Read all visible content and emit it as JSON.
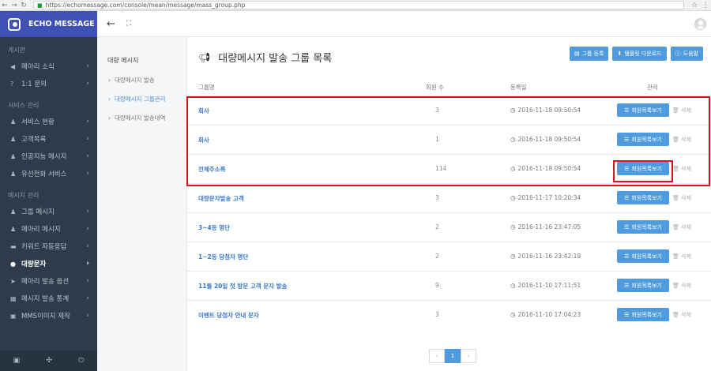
{
  "browser": {
    "url": "https://echomessage.com/console/mean/message/mass_group.php"
  },
  "sidebar": {
    "brand": "ECHO MESSAGE",
    "sections": [
      {
        "title": "게시판",
        "items": [
          {
            "icon": "megaphone-icon",
            "glyph": "◀",
            "label": "메아리 소식",
            "active": false
          },
          {
            "icon": "question-icon",
            "glyph": "?",
            "label": "1:1 문의",
            "active": false
          }
        ]
      },
      {
        "title": "서비스 관리",
        "items": [
          {
            "icon": "users-icon",
            "glyph": "♟",
            "label": "서비스 현황",
            "active": false
          },
          {
            "icon": "users-icon",
            "glyph": "♟",
            "label": "고객목록",
            "active": false
          },
          {
            "icon": "users-icon",
            "glyph": "♟",
            "label": "인공지능 메시지",
            "active": false
          },
          {
            "icon": "users-icon",
            "glyph": "♟",
            "label": "유선전화 서비스",
            "active": false
          }
        ]
      },
      {
        "title": "메시지 관리",
        "items": [
          {
            "icon": "users-icon",
            "glyph": "♟",
            "label": "그룹 메시지",
            "active": false
          },
          {
            "icon": "users-icon",
            "glyph": "♟",
            "label": "메아리 메시지",
            "active": false
          },
          {
            "icon": "comment-icon",
            "glyph": "▬",
            "label": "키워드 자동응답",
            "active": false
          },
          {
            "icon": "chat-icon",
            "glyph": "●",
            "label": "대량문자",
            "active": true
          },
          {
            "icon": "send-icon",
            "glyph": "➤",
            "label": "메아리 발송 옵션",
            "active": false
          },
          {
            "icon": "stats-icon",
            "glyph": "▦",
            "label": "메시지 발송 통계",
            "active": false
          },
          {
            "icon": "image-icon",
            "glyph": "▣",
            "label": "MMS이미지 제작",
            "active": false
          }
        ]
      }
    ]
  },
  "subnav": {
    "title": "대량 메시지",
    "items": [
      {
        "label": "대량메시지 발송",
        "active": false
      },
      {
        "label": "대량메시지 그룹관리",
        "active": true
      },
      {
        "label": "대량메시지 발송내역",
        "active": false
      }
    ]
  },
  "page": {
    "title": "대량메시지 발송 그룹 목록",
    "buttons": {
      "add": "그룹 등록",
      "template": "템플릿 다운로드",
      "help": "도움말"
    }
  },
  "table": {
    "headers": {
      "name": "그룹명",
      "count": "회원 수",
      "date": "등록일",
      "manage": "관리"
    },
    "view_label": "회원목록보기",
    "delete_label": "삭제",
    "rows": [
      {
        "name": "회사",
        "count": "3",
        "date": "2016-11-18 09:50:54"
      },
      {
        "name": "회사",
        "count": "1",
        "date": "2016-11-18 09:50:54"
      },
      {
        "name": "전체주소록",
        "count": "114",
        "date": "2016-11-18 09:50:54"
      },
      {
        "name": "대량문자발송 고객",
        "count": "3",
        "date": "2016-11-17 10:20:34"
      },
      {
        "name": "3~4등 명단",
        "count": "2",
        "date": "2016-11-16 23:47:05"
      },
      {
        "name": "1~2등 당첨자 명단",
        "count": "2",
        "date": "2016-11-16 23:42:19"
      },
      {
        "name": "11월 20일 첫 방문 고객 문자 발송",
        "count": "9",
        "date": "2016-11-10 17:11:51"
      },
      {
        "name": "이벤트 당첨자 안내 문자",
        "count": "3",
        "date": "2016-11-10 17:04:23"
      }
    ]
  },
  "pagination": {
    "prev": "‹",
    "current": "1",
    "next": "›"
  }
}
